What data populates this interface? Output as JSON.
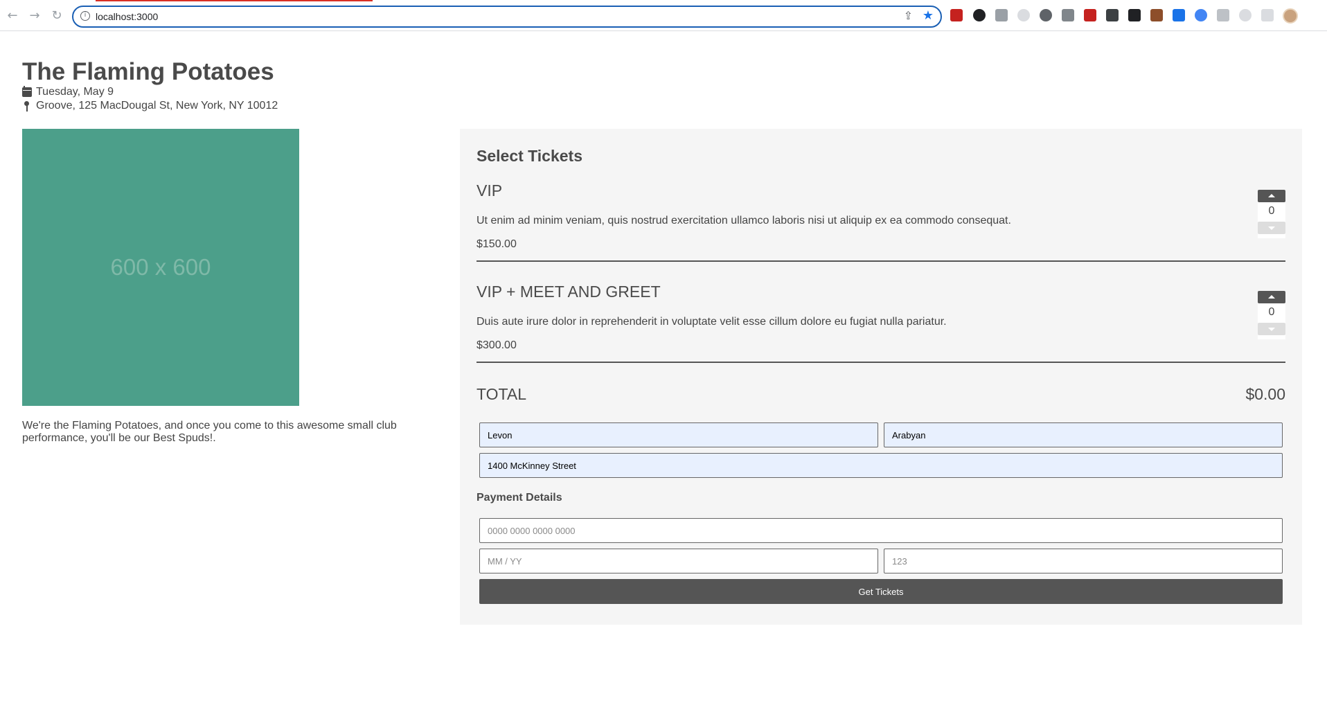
{
  "browser": {
    "url": "localhost:3000",
    "back_icon": "arrow-left-icon",
    "forward_icon": "arrow-right-icon",
    "reload_icon": "reload-icon"
  },
  "event": {
    "title": "The Flaming Potatoes",
    "date": "Tuesday, May 9",
    "venue": "Groove, 125 MacDougal St, New York, NY 10012",
    "image_label": "600 x 600",
    "description": "We're the Flaming Potatoes, and once you come to this awesome small club performance, you'll be our Best Spuds!."
  },
  "tickets": {
    "heading": "Select Tickets",
    "items": [
      {
        "name": "VIP",
        "description": "Ut enim ad minim veniam, quis nostrud exercitation ullamco laboris nisi ut aliquip ex ea commodo consequat.",
        "price": "$150.00",
        "quantity": "0"
      },
      {
        "name": "VIP + MEET AND GREET",
        "description": "Duis aute irure dolor in reprehenderit in voluptate velit esse cillum dolore eu fugiat nulla pariatur.",
        "price": "$300.00",
        "quantity": "0"
      }
    ],
    "total_label": "TOTAL",
    "total_value": "$0.00"
  },
  "form": {
    "first_name": "Levon",
    "last_name": "Arabyan",
    "address": "1400 McKinney Street",
    "payment_heading": "Payment Details",
    "card_placeholder": "0000 0000 0000 0000",
    "expiry_placeholder": "MM / YY",
    "cvc_placeholder": "123",
    "submit_label": "Get Tickets"
  },
  "colors": {
    "image_bg": "#4c9f8a",
    "panel_bg": "#f5f5f5",
    "button_bg": "#555555",
    "autofill_bg": "#e8f0fe"
  }
}
